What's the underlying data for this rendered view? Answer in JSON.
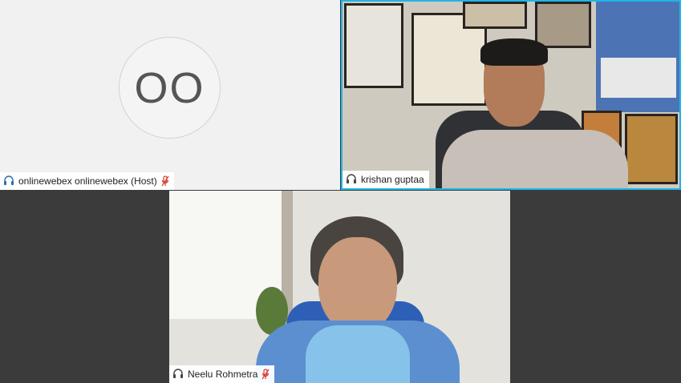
{
  "participants": [
    {
      "name": "onlinewebex onlinewebex (Host)",
      "initials": "OO",
      "headset_icon": "headset-icon",
      "mic_icon": "mic-muted-icon",
      "video": false
    },
    {
      "name": "krishan guptaa",
      "headset_icon": "headset-icon",
      "video": true,
      "active_speaker": true
    },
    {
      "name": "Neelu Rohmetra",
      "headset_icon": "headset-icon",
      "mic_icon": "mic-muted-icon",
      "video": true
    }
  ],
  "colors": {
    "active_speaker_border": "#1fb5e8",
    "muted_mic": "#d9372b",
    "background": "#3b3b3b"
  }
}
